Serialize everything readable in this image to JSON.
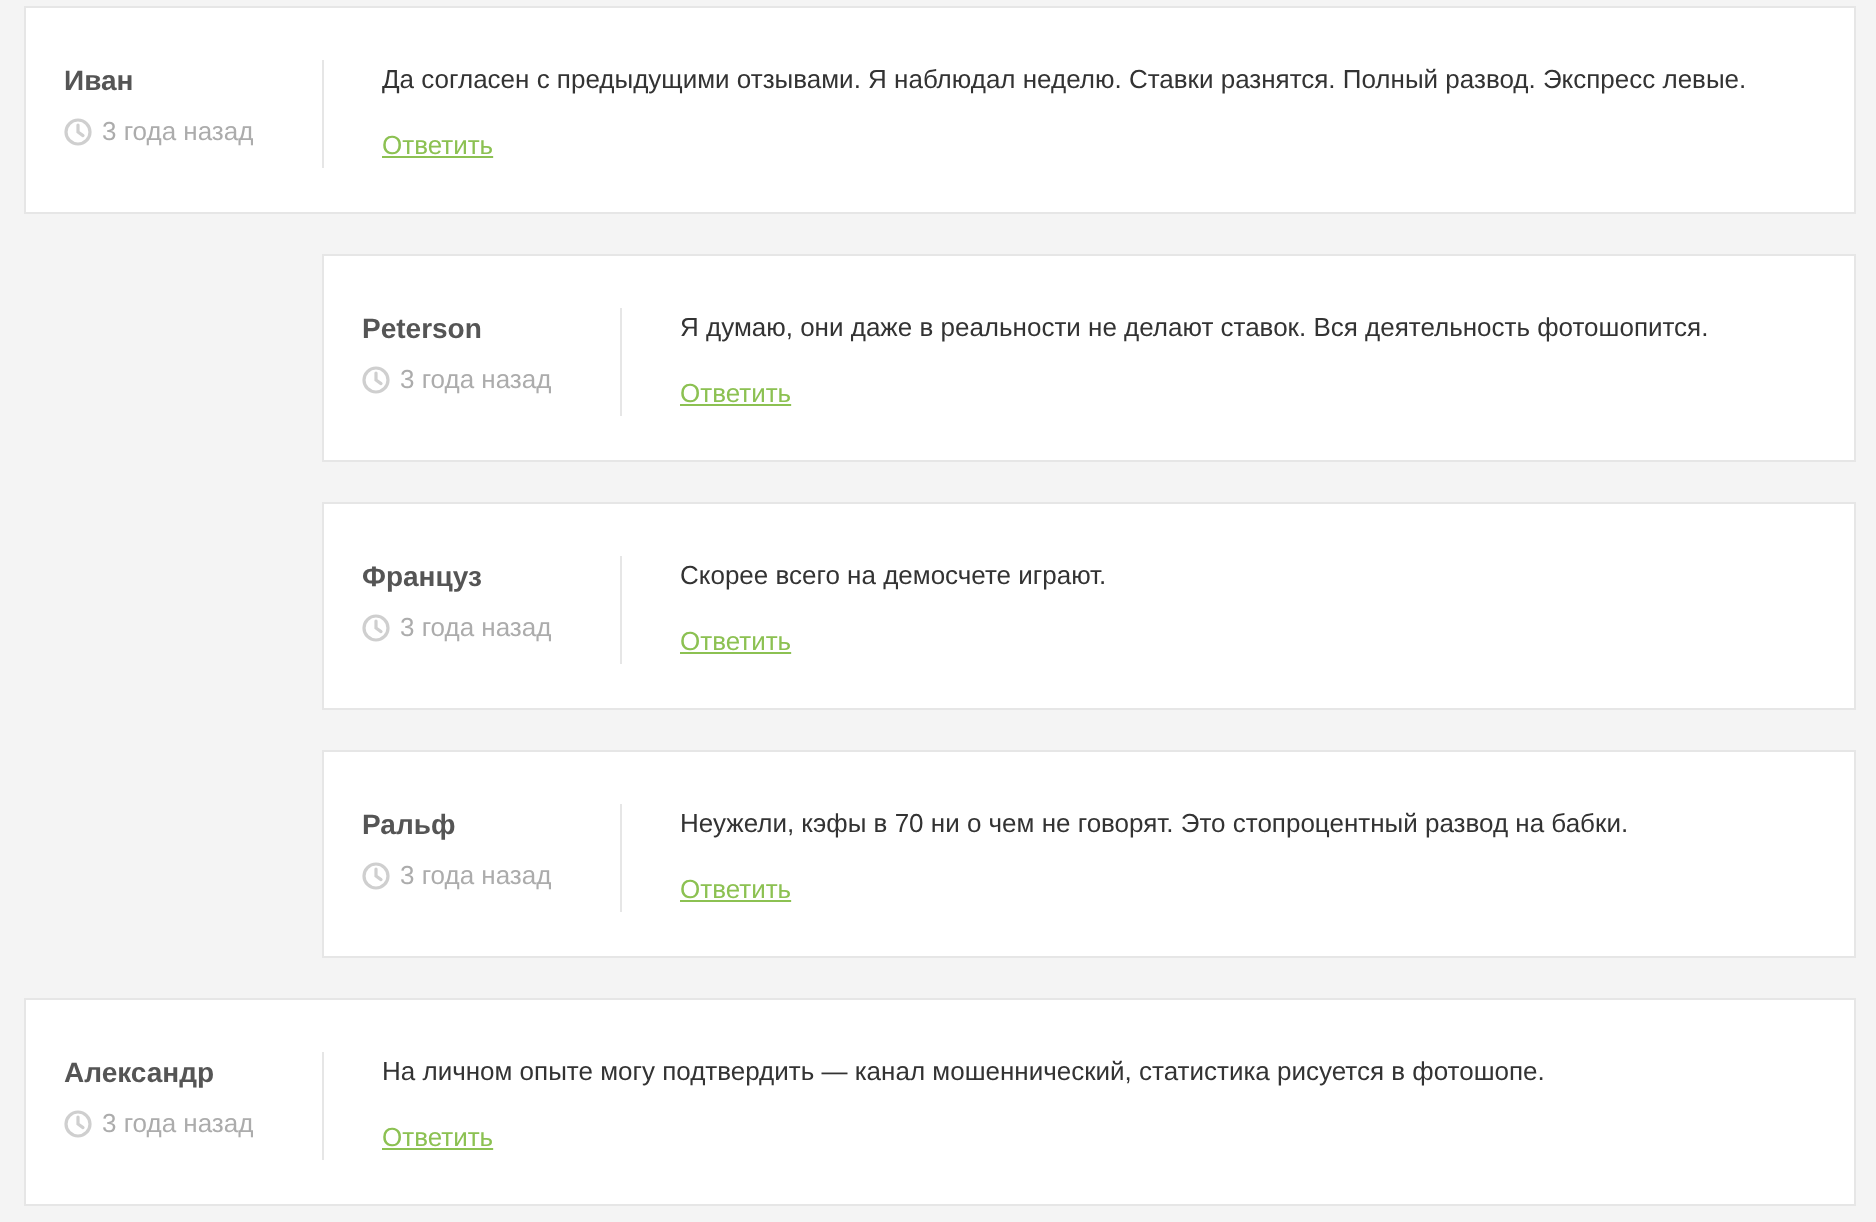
{
  "comments": [
    {
      "author": "Иван",
      "time": "3 года назад",
      "text": "Да согласен с предыдущими отзывами. Я наблюдал неделю. Ставки разнятся. Полный развод. Экспресс левые.",
      "reply_label": "Ответить",
      "children": [
        {
          "author": "Peterson",
          "time": "3 года назад",
          "text": "Я думаю, они даже в реальности не делают ставок. Вся деятельность фотошопится.",
          "reply_label": "Ответить"
        },
        {
          "author": "Француз",
          "time": "3 года назад",
          "text": "Скорее всего на демосчете играют.",
          "reply_label": "Ответить"
        },
        {
          "author": "Ральф",
          "time": "3 года назад",
          "text": "Неужели, кэфы в 70 ни о чем не говорят. Это стопроцентный развод на бабки.",
          "reply_label": "Ответить"
        }
      ]
    },
    {
      "author": "Александр",
      "time": "3 года назад",
      "text": "На личном опыте могу подтвердить — канал мошеннический, статистика рисуется в фотошопе.",
      "reply_label": "Ответить"
    }
  ]
}
